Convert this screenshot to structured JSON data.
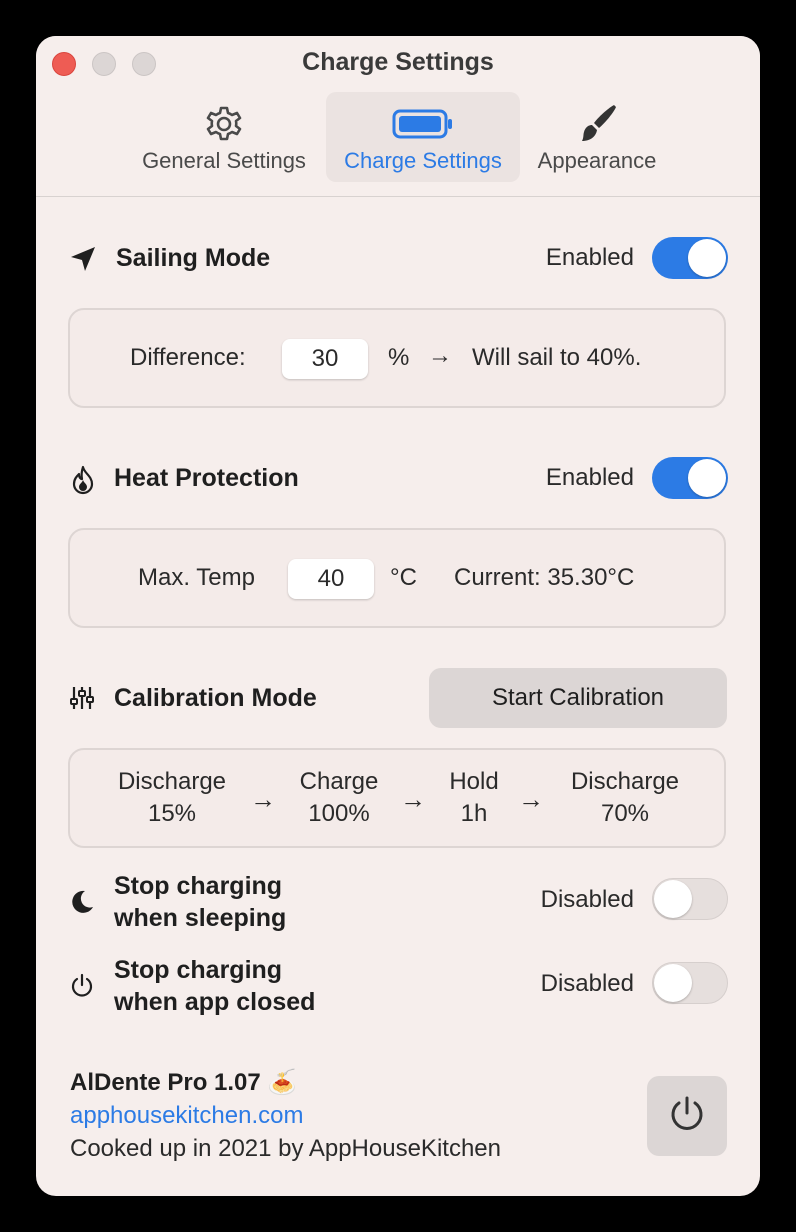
{
  "window": {
    "title": "Charge Settings"
  },
  "tabs": [
    {
      "label": "General Settings",
      "icon": "gear-icon"
    },
    {
      "label": "Charge Settings",
      "icon": "battery-icon"
    },
    {
      "label": "Appearance",
      "icon": "paintbrush-icon"
    }
  ],
  "sailing": {
    "title": "Sailing Mode",
    "status": "Enabled",
    "enabled": true,
    "difference_label": "Difference:",
    "difference_value": "30",
    "unit": "%",
    "arrow": "→",
    "result": "Will sail to 40%."
  },
  "heat": {
    "title": "Heat Protection",
    "status": "Enabled",
    "enabled": true,
    "max_label": "Max. Temp",
    "max_value": "40",
    "unit": "°C",
    "current": "Current: 35.30°C"
  },
  "calibration": {
    "title": "Calibration Mode",
    "button": "Start Calibration",
    "steps": [
      {
        "top": "Discharge",
        "bottom": "15%"
      },
      {
        "top": "Charge",
        "bottom": "100%"
      },
      {
        "top": "Hold",
        "bottom": "1h"
      },
      {
        "top": "Discharge",
        "bottom": "70%"
      }
    ],
    "arrow": "→"
  },
  "sleep": {
    "line1": "Stop charging",
    "line2": "when sleeping",
    "status": "Disabled",
    "enabled": false
  },
  "closed": {
    "line1": "Stop charging",
    "line2": "when app closed",
    "status": "Disabled",
    "enabled": false
  },
  "footer": {
    "title": "AlDente Pro 1.07",
    "emoji": "🍝",
    "link": "apphousekitchen.com",
    "credit": "Cooked up in 2021 by AppHouseKitchen"
  },
  "colors": {
    "accent": "#2c7be5",
    "close": "#ee5c54"
  }
}
